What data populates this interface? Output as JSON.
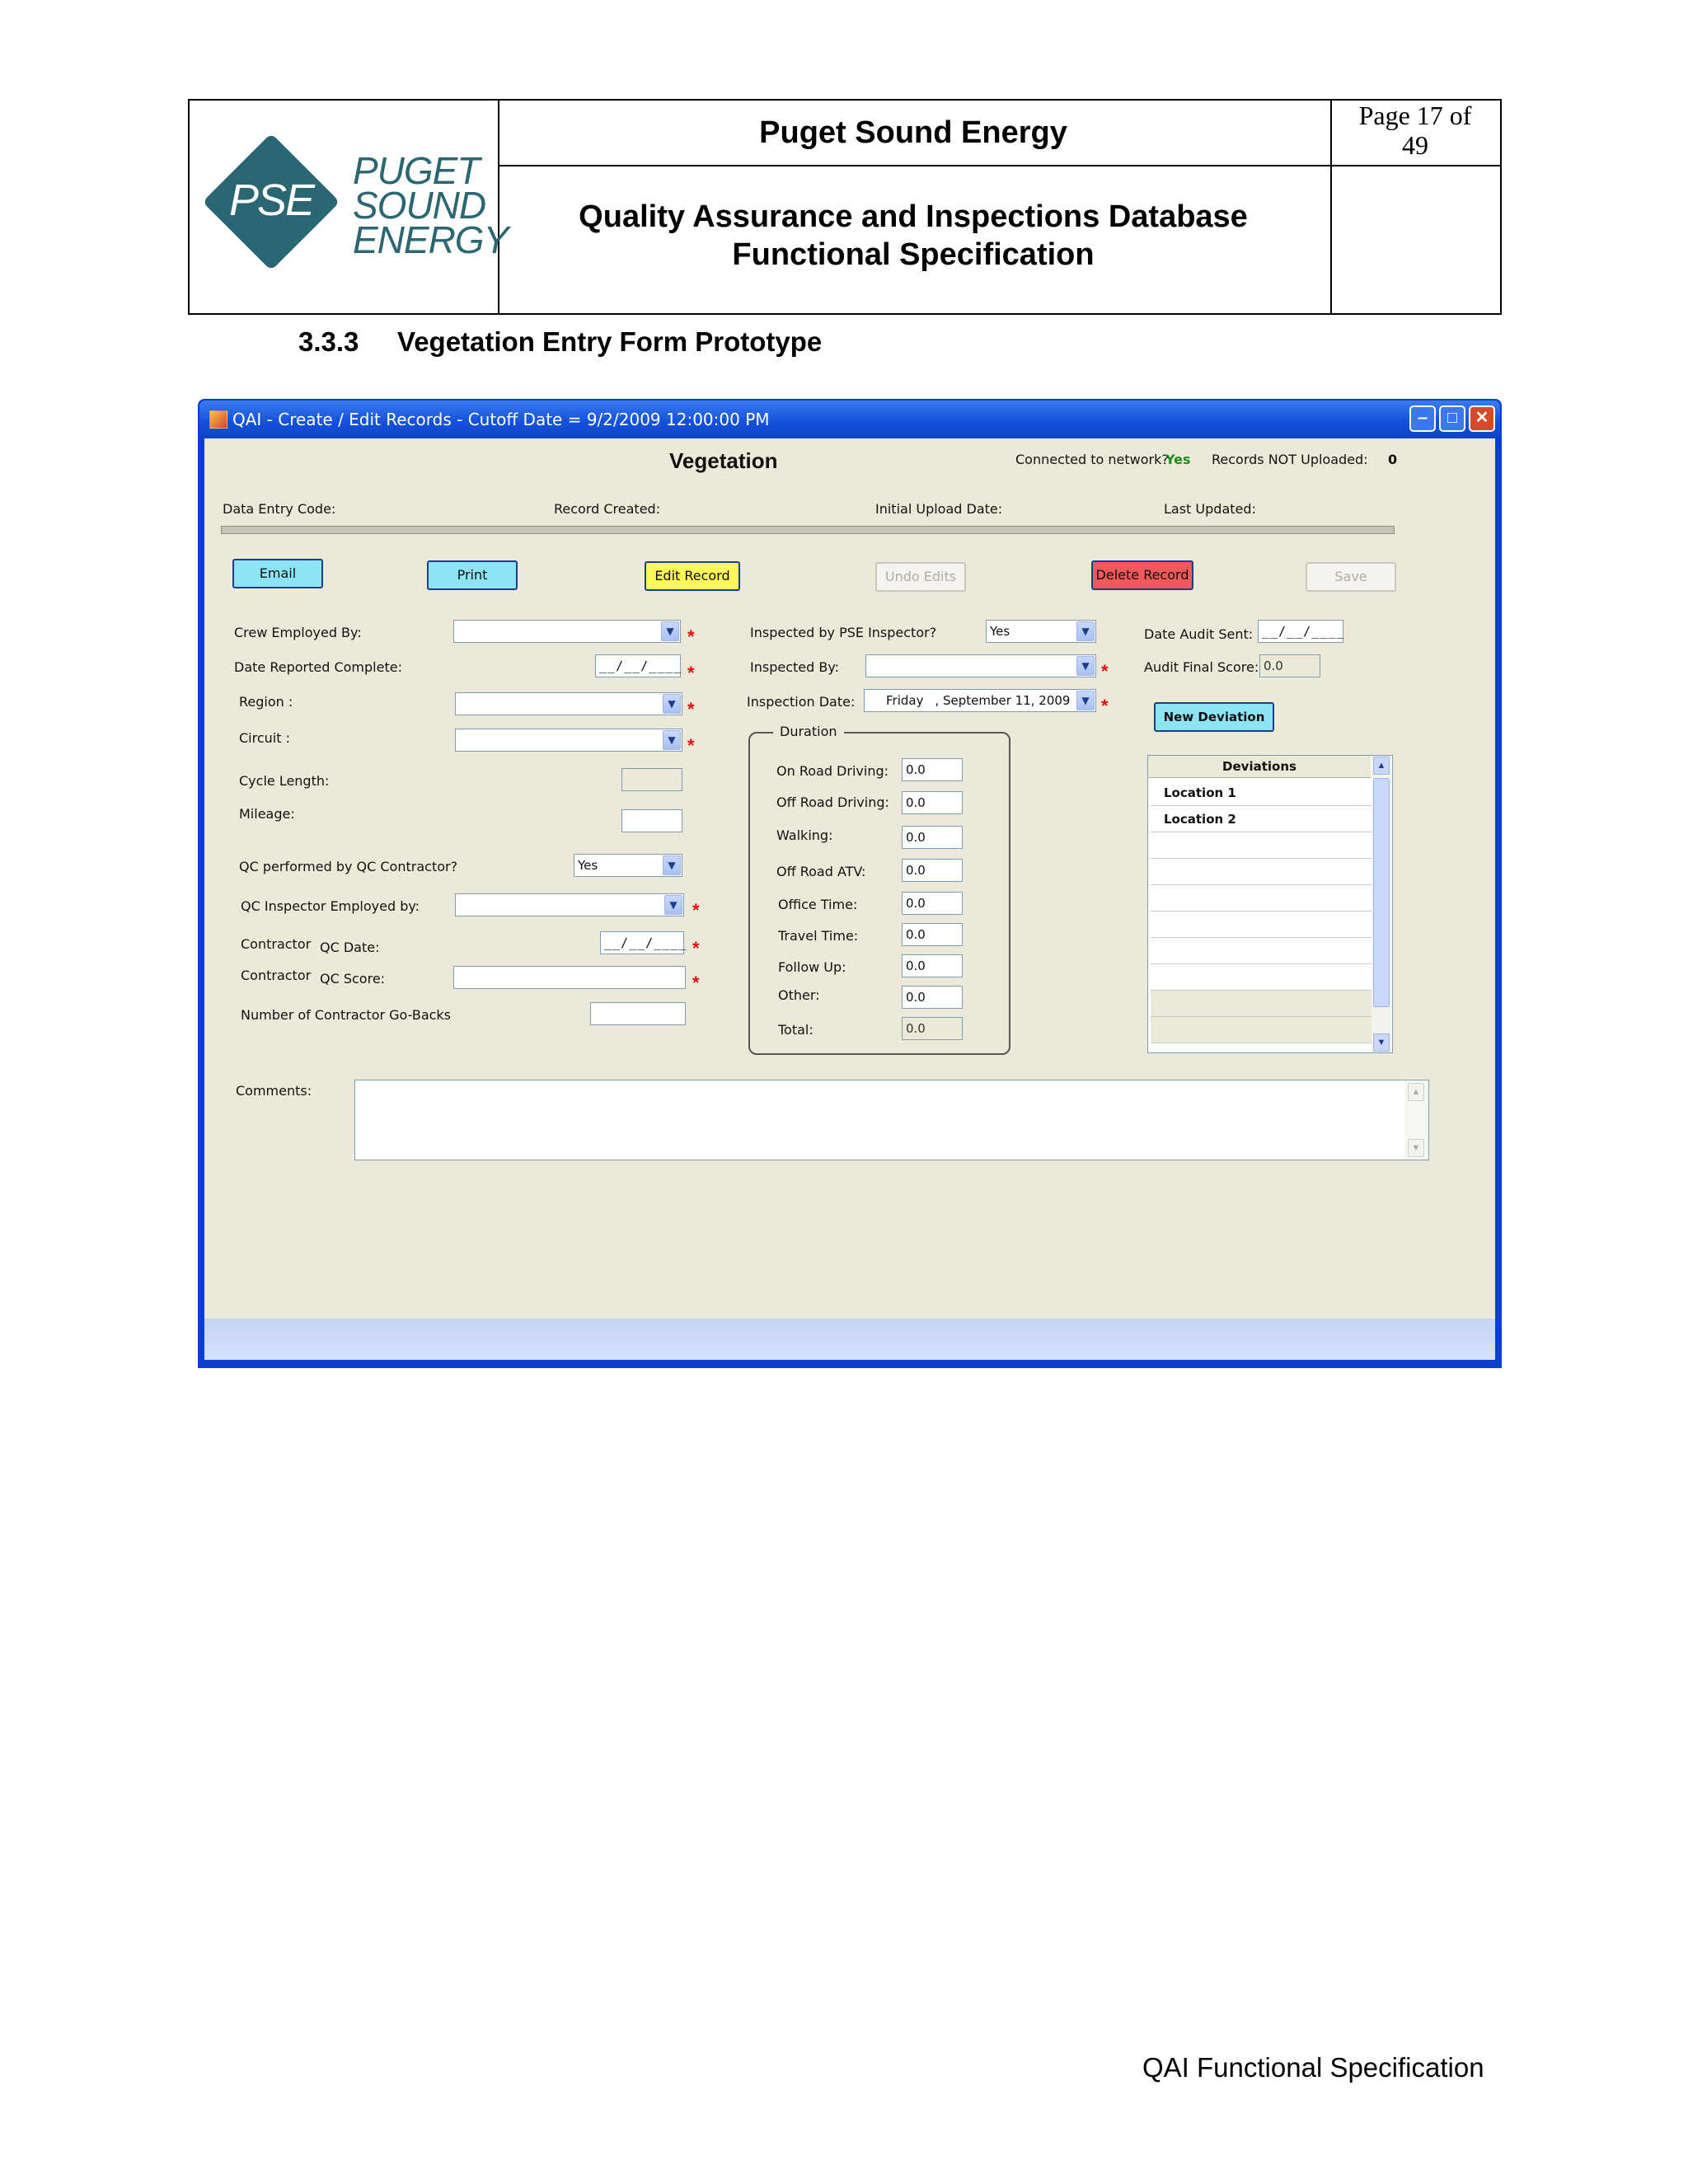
{
  "header": {
    "logo_text": "PSE",
    "logo_words": [
      "PUGET",
      "SOUND",
      "ENERGY"
    ],
    "company": "Puget Sound Energy",
    "doc_title_line1": "Quality Assurance and Inspections Database",
    "doc_title_line2": "Functional Specification",
    "page_label": "Page 17 of",
    "page_total": "49"
  },
  "section": {
    "number": "3.3.3",
    "title": "Vegetation Entry Form Prototype"
  },
  "window": {
    "title": "QAI - Create / Edit Records - Cutoff Date = 9/2/2009 12:00:00 PM",
    "form_title": "Vegetation",
    "connected_label": "Connected to network?",
    "connected_value": "Yes",
    "records_label": "Records NOT Uploaded:",
    "records_value": "0",
    "info": {
      "data_entry_code": "Data Entry Code:",
      "record_created": "Record Created:",
      "initial_upload": "Initial Upload Date:",
      "last_updated": "Last Updated:"
    },
    "buttons": {
      "email": "Email",
      "print": "Print",
      "edit_record": "Edit Record",
      "undo_edits": "Undo Edits",
      "delete_record": "Delete Record",
      "save": "Save",
      "new_deviation": "New Deviation"
    },
    "left": {
      "crew_employed_by": "Crew Employed By:",
      "date_reported_complete": "Date Reported Complete:",
      "region": "Region :",
      "circuit": "Circuit :",
      "cycle_length": "Cycle Length:",
      "mileage": "Mileage:",
      "qc_performed": "QC performed by QC Contractor?",
      "qc_performed_value": "Yes",
      "qc_inspector_employed": "QC Inspector Employed by:",
      "contractor": "Contractor",
      "qc_date": "QC Date:",
      "qc_score": "QC  Score:",
      "go_backs": "Number of Contractor Go-Backs"
    },
    "middle": {
      "inspected_by_pse": "Inspected by PSE Inspector?",
      "inspected_by_pse_value": "Yes",
      "inspected_by": "Inspected By:",
      "inspection_date": "Inspection Date:",
      "inspection_day": "Friday",
      "inspection_date_value": ", September 11, 2009",
      "duration_title": "Duration",
      "duration": [
        {
          "label": "On Road Driving:",
          "value": "0.0"
        },
        {
          "label": "Off Road Driving:",
          "value": "0.0"
        },
        {
          "label": "Walking:",
          "value": "0.0"
        },
        {
          "label": "Off Road ATV:",
          "value": "0.0"
        },
        {
          "label": "Office Time:",
          "value": "0.0"
        },
        {
          "label": "Travel Time:",
          "value": "0.0"
        },
        {
          "label": "Follow Up:",
          "value": "0.0"
        },
        {
          "label": "Other:",
          "value": "0.0"
        },
        {
          "label": "Total:",
          "value": "0.0"
        }
      ]
    },
    "right": {
      "date_audit_sent": "Date Audit Sent:",
      "audit_final_score": "Audit Final Score:",
      "audit_final_score_value": "0.0",
      "deviations_header": "Deviations",
      "deviations": [
        "Location 1",
        "Location 2"
      ]
    },
    "date_mask": "__/__/____",
    "comments_label": "Comments:"
  },
  "footer": "QAI Functional Specification",
  "colors": {
    "pse_teal": "#2b6773",
    "required": "#e01010",
    "connected_yes": "#1e8a1e"
  }
}
